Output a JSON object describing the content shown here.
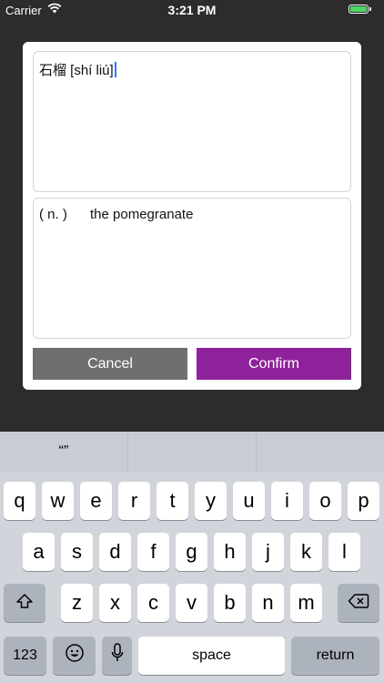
{
  "status_bar": {
    "carrier": "Carrier",
    "time": "3:21 PM",
    "battery_level": 1.0,
    "battery_color": "#4cd964"
  },
  "dialog": {
    "word_value": "石榴 [shí liú]",
    "definition": {
      "part_of_speech": "( n. )",
      "meaning": "the pomegranate"
    },
    "cancel_label": "Cancel",
    "confirm_label": "Confirm",
    "confirm_color": "#8e229b",
    "cancel_color": "#6f6f6f"
  },
  "keyboard": {
    "suggestions": [
      "“”",
      "",
      ""
    ],
    "row1": [
      "q",
      "w",
      "e",
      "r",
      "t",
      "y",
      "u",
      "i",
      "o",
      "p"
    ],
    "row2": [
      "a",
      "s",
      "d",
      "f",
      "g",
      "h",
      "j",
      "k",
      "l"
    ],
    "row3": [
      "z",
      "x",
      "c",
      "v",
      "b",
      "n",
      "m"
    ],
    "numbers_label": "123",
    "space_label": "space",
    "return_label": "return"
  }
}
